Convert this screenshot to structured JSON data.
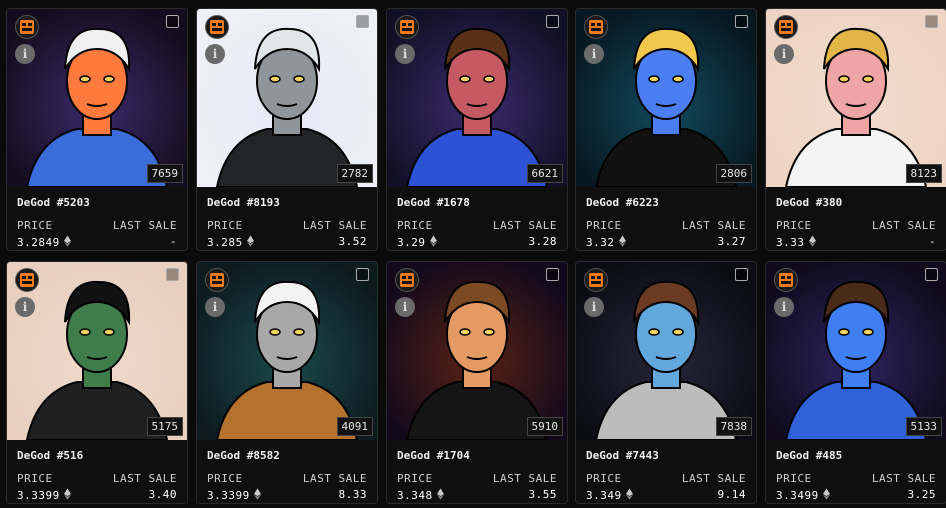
{
  "cards": [
    {
      "name": "DeGod #5203",
      "token": "7659",
      "price": "3.2849",
      "last_sale": "-",
      "bg": "#140d1e",
      "glow": "#3a2a6a",
      "skin": "#ff7a3d",
      "hair": "#f0f0f0",
      "shirt": "#3b6dd8"
    },
    {
      "name": "DeGod #8193",
      "token": "2782",
      "price": "3.285",
      "last_sale": "3.52",
      "bg": "#eef0f6",
      "glow": "#e6e9f5",
      "skin": "#8e969c",
      "hair": "#dfe6e8",
      "shirt": "#222428"
    },
    {
      "name": "DeGod #1678",
      "token": "6621",
      "price": "3.29",
      "last_sale": "3.28",
      "bg": "#121026",
      "glow": "#3a2b6f",
      "skin": "#c65a63",
      "hair": "#5b3018",
      "shirt": "#2c53d6"
    },
    {
      "name": "DeGod #6223",
      "token": "2806",
      "price": "3.32",
      "last_sale": "3.27",
      "bg": "#071821",
      "glow": "#114a5e",
      "skin": "#4b7ef0",
      "hair": "#f2c84c",
      "shirt": "#111"
    },
    {
      "name": "DeGod #380",
      "token": "8123",
      "price": "3.33",
      "last_sale": "-",
      "bg": "#eed4c2",
      "glow": "#f2dccc",
      "skin": "#efa5a5",
      "hair": "#e3b547",
      "shirt": "#f4f4f4"
    },
    {
      "name": "DeGod #516",
      "token": "5175",
      "price": "3.3399",
      "last_sale": "3.40",
      "bg": "#e8cfbe",
      "glow": "#efd9c9",
      "skin": "#3f7d4a",
      "hair": "#111",
      "shirt": "#202020"
    },
    {
      "name": "DeGod #8582",
      "token": "4091",
      "price": "3.3399",
      "last_sale": "8.33",
      "bg": "#0d1b1f",
      "glow": "#19494c",
      "skin": "#a8a8a8",
      "hair": "#f3f3f3",
      "shirt": "#b5722e"
    },
    {
      "name": "DeGod #1704",
      "token": "5910",
      "price": "3.348",
      "last_sale": "3.55",
      "bg": "#12091c",
      "glow": "#5a2214",
      "skin": "#e49a62",
      "hair": "#7b4a22",
      "shirt": "#151515"
    },
    {
      "name": "DeGod #7443",
      "token": "7838",
      "price": "3.349",
      "last_sale": "9.14",
      "bg": "#0c0c14",
      "glow": "#26263a",
      "skin": "#62a8dc",
      "hair": "#6b3a22",
      "shirt": "#bcbcbc"
    },
    {
      "name": "DeGod #485",
      "token": "5133",
      "price": "3.3499",
      "last_sale": "3.25",
      "bg": "#0f0b1c",
      "glow": "#2c2460",
      "skin": "#3f7ef2",
      "hair": "#4a2a18",
      "shirt": "#2f62d8"
    }
  ],
  "labels": {
    "price": "PRICE",
    "last_sale": "LAST SALE"
  },
  "icons": {
    "badge": "bl-badge-icon",
    "info": "info-icon",
    "checkbox": "checkbox-icon",
    "eth": "eth-icon"
  }
}
